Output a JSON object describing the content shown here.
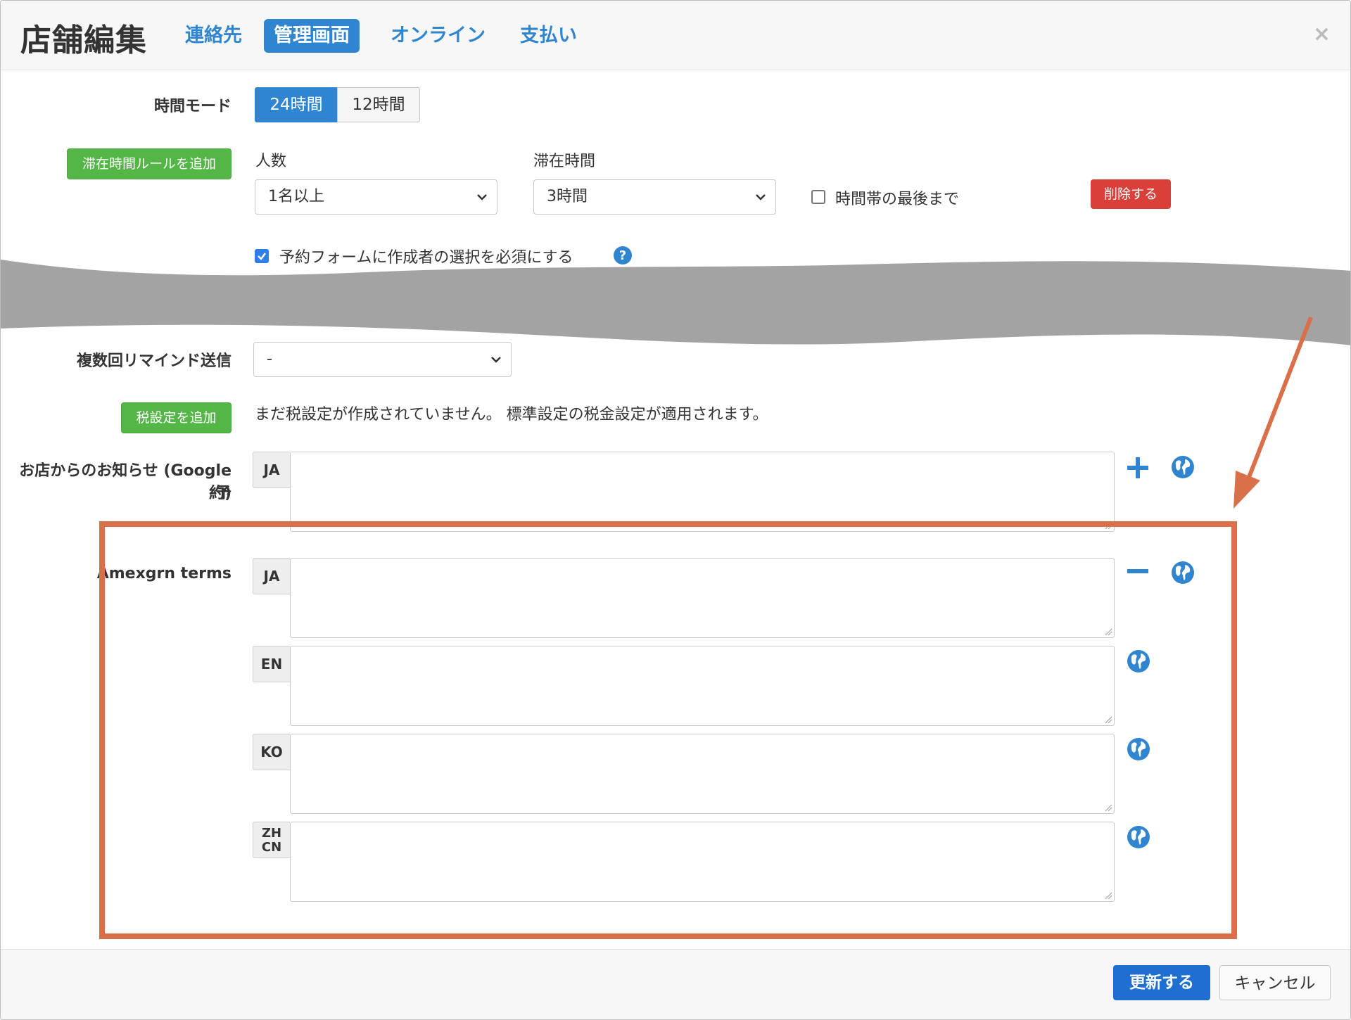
{
  "header": {
    "title": "店舗編集",
    "tabs": [
      {
        "label": "連絡先",
        "active": false
      },
      {
        "label": "管理画面",
        "active": true
      },
      {
        "label": "オンライン",
        "active": false
      },
      {
        "label": "支払い",
        "active": false
      }
    ],
    "close": "×"
  },
  "time_mode": {
    "label": "時間モード",
    "options": [
      "24時間",
      "12時間"
    ],
    "selected": "24時間"
  },
  "stay_rule": {
    "add_button": "滞在時間ルールを追加",
    "people_label": "人数",
    "people_value": "1名以上",
    "duration_label": "滞在時間",
    "duration_value": "3時間",
    "until_end_label": "時間帯の最後まで",
    "until_end_checked": false,
    "delete_button": "削除する"
  },
  "require_creator": {
    "label": "予約フォームに作成者の選択を必須にする",
    "checked": true,
    "help_icon": "question-circle-icon"
  },
  "multi_reminder": {
    "label": "複数回リマインド送信",
    "value": "-"
  },
  "tax": {
    "add_button": "税設定を追加",
    "message": "まだ税設定が作成されていません。 標準設定の税金設定が適用されます。"
  },
  "shop_notice": {
    "label_line1": "お店からのお知らせ (Google予",
    "label_line2": "約)",
    "lang": "JA"
  },
  "amexgrn_terms": {
    "label": "Amexgrn terms",
    "langs": [
      "JA",
      "EN",
      "KO",
      "ZH CN"
    ]
  },
  "footer": {
    "update_button": "更新する",
    "cancel_button": "キャンセル"
  },
  "colors": {
    "primary": "#2f85cf",
    "green": "#55b648",
    "red": "#d9403a",
    "highlight": "#d9704a",
    "break": "#a3a3a3"
  }
}
